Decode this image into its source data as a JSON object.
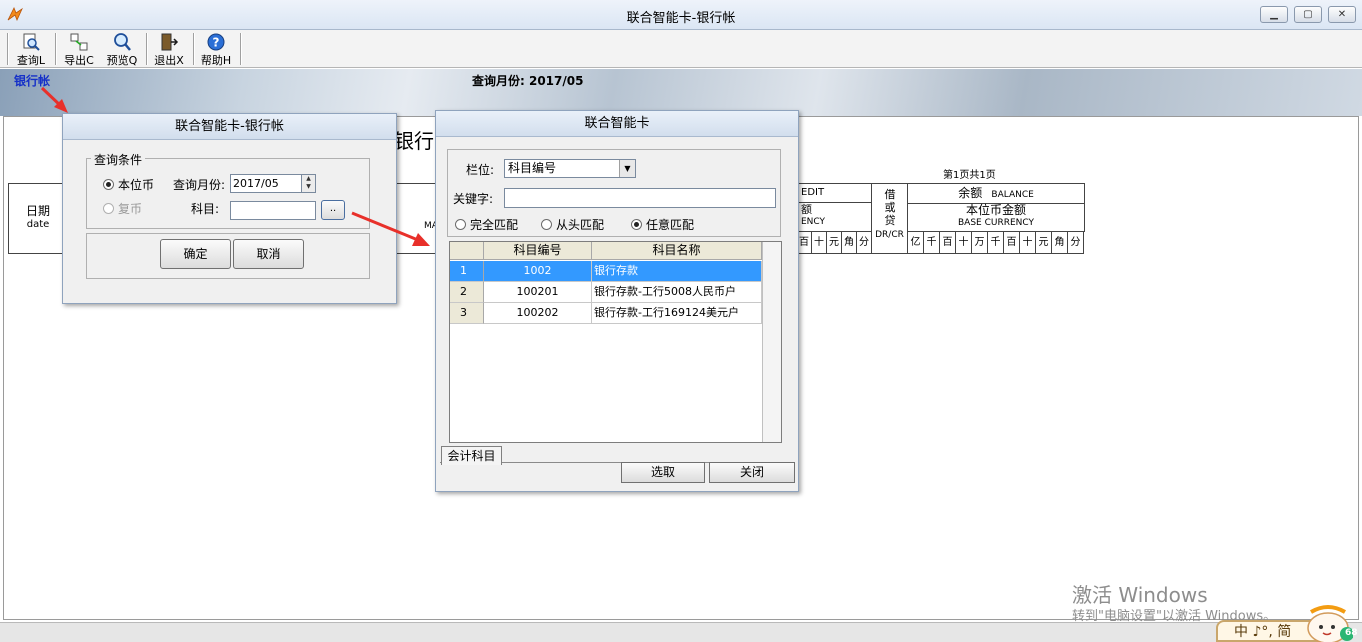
{
  "window": {
    "title": "联合智能卡-银行帐"
  },
  "toolbar": {
    "items": [
      {
        "label": "查询L",
        "icon": "query-icon"
      },
      {
        "label": "导出C",
        "icon": "export-icon"
      },
      {
        "label": "预览Q",
        "icon": "preview-icon"
      },
      {
        "label": "退出X",
        "icon": "exit-icon"
      },
      {
        "label": "帮助H",
        "icon": "help-icon"
      }
    ]
  },
  "banner": {
    "subtitle": "银行帐",
    "month_text": "查询月份: 2017/05"
  },
  "report": {
    "title_fragment": "银行",
    "page_info": "第1页共1页",
    "left_header": {
      "date_cn": "日期",
      "date_en": "date",
      "partial": "MA"
    },
    "credit": {
      "partial_en": "EDIT",
      "amount_cn": "额",
      "currency_partial": "ENCY",
      "digits": [
        "百",
        "十",
        "元",
        "角",
        "分"
      ]
    },
    "dc": {
      "cn": "借或贷",
      "en": "DR/CR"
    },
    "balance": {
      "title_cn": "余额",
      "title_en": "BALANCE",
      "base_cn": "本位币金额",
      "base_en": "BASE CURRENCY",
      "digits": [
        "亿",
        "千",
        "百",
        "十",
        "万",
        "千",
        "百",
        "十",
        "元",
        "角",
        "分"
      ]
    }
  },
  "dialog_query": {
    "title": "联合智能卡-银行帐",
    "group_caption": "查询条件",
    "radio_local": "本位币",
    "radio_foreign": "复币",
    "month_label": "查询月份:",
    "month_value": "2017/05",
    "subject_label": "科目:",
    "subject_value": "",
    "browse_label": "..",
    "ok": "确定",
    "cancel": "取消"
  },
  "dialog_select": {
    "title": "联合智能卡",
    "field_label": "栏位:",
    "field_value": "科目编号",
    "keyword_label": "关键字:",
    "keyword_value": "",
    "match_exact": "完全匹配",
    "match_prefix": "从头匹配",
    "match_any": "任意匹配",
    "columns": [
      "科目编号",
      "科目名称"
    ],
    "rows": [
      {
        "idx": "1",
        "code": "1002",
        "name": "银行存款"
      },
      {
        "idx": "2",
        "code": "100201",
        "name": "银行存款-工行5008人民币户"
      },
      {
        "idx": "3",
        "code": "100202",
        "name": "银行存款-工行169124美元户"
      }
    ],
    "tab": "会计科目",
    "select": "选取",
    "close": "关闭"
  },
  "watermark": {
    "line1": "激活 Windows",
    "line2": "转到\"电脑设置\"以激活 Windows。"
  },
  "ime": {
    "text": "中 ♪°, 简",
    "badge": "68"
  },
  "colors": {
    "accent": "#3399ff",
    "subtitle": "#1530c8",
    "arrow": "#e8302a"
  }
}
